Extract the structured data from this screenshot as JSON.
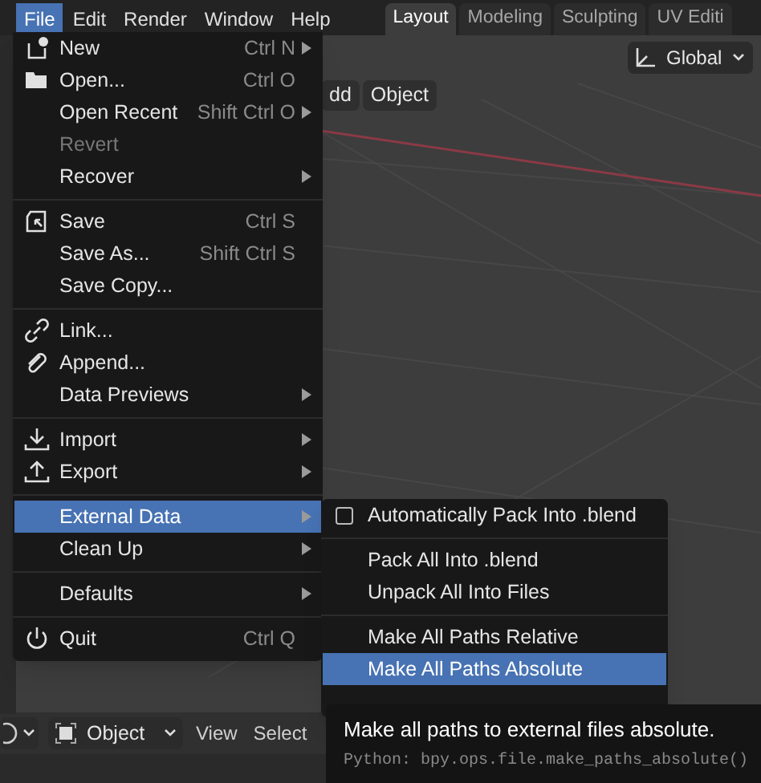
{
  "menubar": [
    {
      "label": "File",
      "selected": true
    },
    {
      "label": "Edit",
      "selected": false
    },
    {
      "label": "Render",
      "selected": false
    },
    {
      "label": "Window",
      "selected": false
    },
    {
      "label": "Help",
      "selected": false
    }
  ],
  "workspace_tabs": [
    {
      "label": "Layout",
      "selected": true
    },
    {
      "label": "Modeling",
      "selected": false
    },
    {
      "label": "Sculpting",
      "selected": false
    },
    {
      "label": "UV Editi",
      "selected": false
    }
  ],
  "viewport": {
    "orientation": "Global",
    "header_buttons": [
      "dd",
      "Object"
    ]
  },
  "file_menu": [
    {
      "kind": "item",
      "label": "New",
      "shortcut": "Ctrl N",
      "submenu": true,
      "disabled": false,
      "selected": false
    },
    {
      "kind": "item",
      "label": "Open...",
      "shortcut": "Ctrl O",
      "submenu": false,
      "disabled": false,
      "selected": false
    },
    {
      "kind": "item",
      "label": "Open Recent",
      "shortcut": "Shift Ctrl O",
      "submenu": true,
      "disabled": false,
      "selected": false
    },
    {
      "kind": "item",
      "label": "Revert",
      "submenu": false,
      "disabled": true,
      "selected": false
    },
    {
      "kind": "item",
      "label": "Recover",
      "submenu": true,
      "disabled": false,
      "selected": false
    },
    {
      "kind": "separator"
    },
    {
      "kind": "item",
      "label": "Save",
      "shortcut": "Ctrl S",
      "submenu": false,
      "disabled": false,
      "selected": false
    },
    {
      "kind": "item",
      "label": "Save As...",
      "shortcut": "Shift Ctrl S",
      "submenu": false,
      "disabled": false,
      "selected": false
    },
    {
      "kind": "item",
      "label": "Save Copy...",
      "submenu": false,
      "disabled": false,
      "selected": false
    },
    {
      "kind": "separator"
    },
    {
      "kind": "item",
      "label": "Link...",
      "submenu": false,
      "disabled": false,
      "selected": false
    },
    {
      "kind": "item",
      "label": "Append...",
      "submenu": false,
      "disabled": false,
      "selected": false
    },
    {
      "kind": "item",
      "label": "Data Previews",
      "submenu": true,
      "disabled": false,
      "selected": false
    },
    {
      "kind": "separator"
    },
    {
      "kind": "item",
      "label": "Import",
      "submenu": true,
      "disabled": false,
      "selected": false
    },
    {
      "kind": "item",
      "label": "Export",
      "submenu": true,
      "disabled": false,
      "selected": false
    },
    {
      "kind": "separator"
    },
    {
      "kind": "item",
      "label": "External Data",
      "submenu": true,
      "disabled": false,
      "selected": true
    },
    {
      "kind": "item",
      "label": "Clean Up",
      "submenu": true,
      "disabled": false,
      "selected": false
    },
    {
      "kind": "separator"
    },
    {
      "kind": "item",
      "label": "Defaults",
      "submenu": true,
      "disabled": false,
      "selected": false
    },
    {
      "kind": "separator"
    },
    {
      "kind": "item",
      "label": "Quit",
      "shortcut": "Ctrl Q",
      "submenu": false,
      "disabled": false,
      "selected": false
    }
  ],
  "external_data_menu": [
    {
      "kind": "checkbox",
      "label": "Automatically Pack Into .blend",
      "checked": false,
      "selected": false
    },
    {
      "kind": "separator"
    },
    {
      "kind": "item",
      "label": "Pack All Into .blend",
      "selected": false
    },
    {
      "kind": "item",
      "label": "Unpack All Into Files",
      "selected": false
    },
    {
      "kind": "separator"
    },
    {
      "kind": "item",
      "label": "Make All Paths Relative",
      "selected": false
    },
    {
      "kind": "item",
      "label": "Make All Paths Absolute",
      "selected": true
    }
  ],
  "tooltip": {
    "text": "Make all paths to external files absolute.",
    "python": "Python: bpy.ops.file.make_paths_absolute()"
  },
  "bottom_header": {
    "mode": "Object",
    "menus": [
      "View",
      "Select"
    ]
  }
}
